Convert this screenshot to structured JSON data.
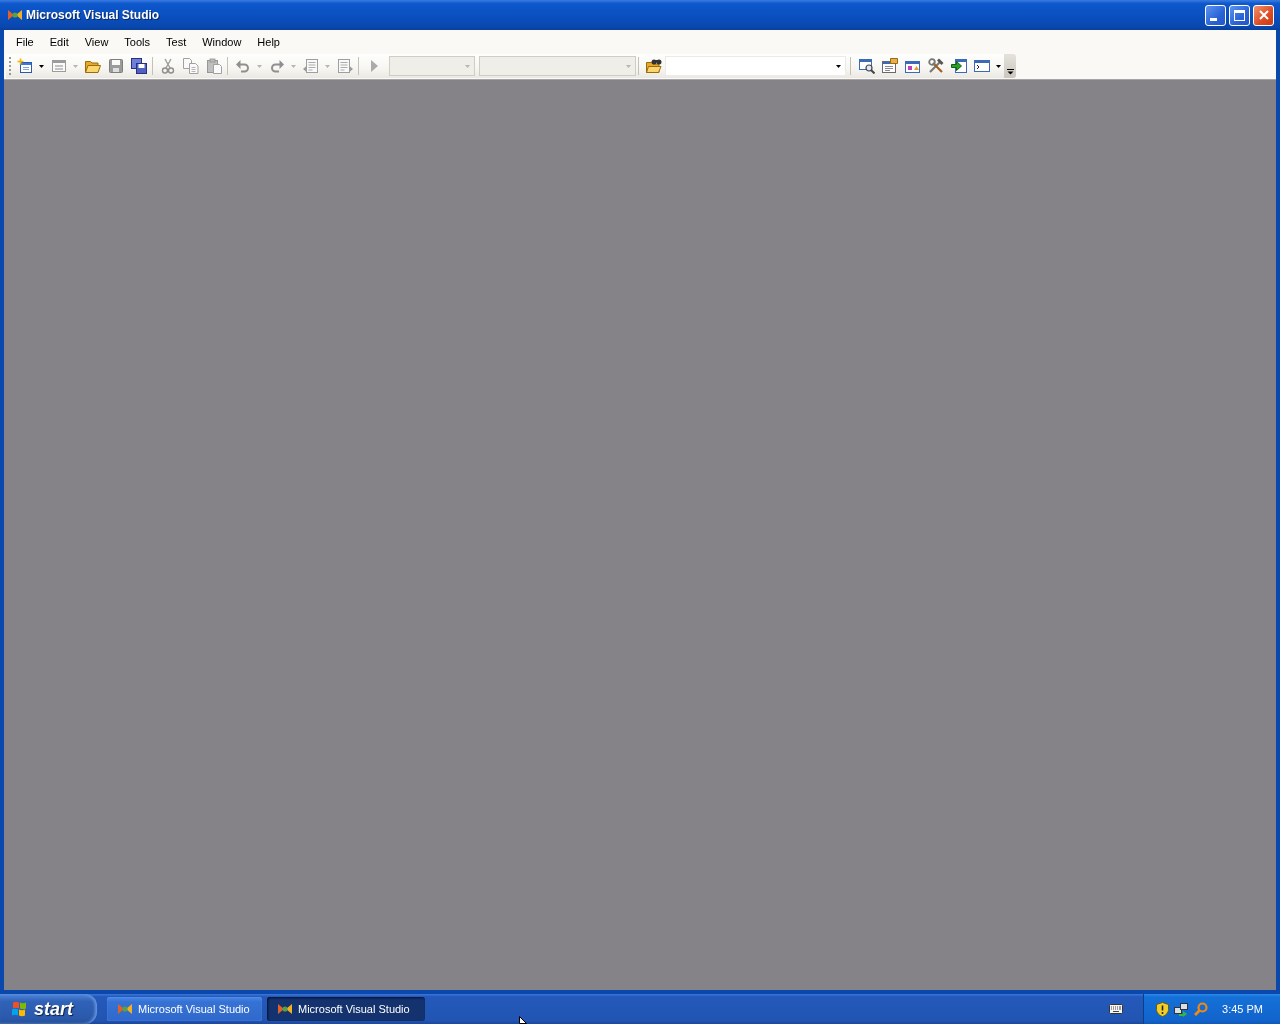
{
  "window": {
    "title": "Microsoft Visual Studio"
  },
  "menu": [
    {
      "label": "File"
    },
    {
      "label": "Edit"
    },
    {
      "label": "View"
    },
    {
      "label": "Tools"
    },
    {
      "label": "Test"
    },
    {
      "label": "Window"
    },
    {
      "label": "Help"
    }
  ],
  "toolbar": [
    {
      "kind": "new_project",
      "disabled": false,
      "dropdown": true
    },
    {
      "kind": "add_item",
      "disabled": true,
      "dropdown": true
    },
    {
      "kind": "open",
      "disabled": false
    },
    {
      "kind": "save",
      "disabled": true
    },
    {
      "kind": "save_all",
      "disabled": false
    },
    {
      "kind": "separator"
    },
    {
      "kind": "cut",
      "disabled": true
    },
    {
      "kind": "copy",
      "disabled": true
    },
    {
      "kind": "paste",
      "disabled": true
    },
    {
      "kind": "separator"
    },
    {
      "kind": "undo",
      "disabled": true,
      "dropdown": true
    },
    {
      "kind": "redo",
      "disabled": true,
      "dropdown": true
    },
    {
      "kind": "navigate_backward",
      "disabled": true,
      "dropdown": true
    },
    {
      "kind": "navigate_forward",
      "disabled": true
    },
    {
      "kind": "separator"
    },
    {
      "kind": "start",
      "disabled": true
    },
    {
      "kind": "config_combo",
      "disabled": true
    },
    {
      "kind": "platform_combo",
      "disabled": true
    },
    {
      "kind": "separator"
    },
    {
      "kind": "find_in_files",
      "disabled": false
    },
    {
      "kind": "find_combo",
      "disabled": false
    },
    {
      "kind": "separator"
    },
    {
      "kind": "solution_explorer",
      "disabled": false
    },
    {
      "kind": "properties",
      "disabled": false
    },
    {
      "kind": "object_browser",
      "disabled": false
    },
    {
      "kind": "toolbox",
      "disabled": false
    },
    {
      "kind": "start_page",
      "disabled": false
    },
    {
      "kind": "command_window",
      "disabled": false,
      "dropdown": true
    }
  ],
  "taskbar": {
    "start_button": "start",
    "tasks": [
      {
        "label": "Microsoft Visual Studio",
        "selected": false
      },
      {
        "label": "Microsoft Visual Studio",
        "selected": true
      }
    ],
    "clock": "3:45 PM"
  }
}
